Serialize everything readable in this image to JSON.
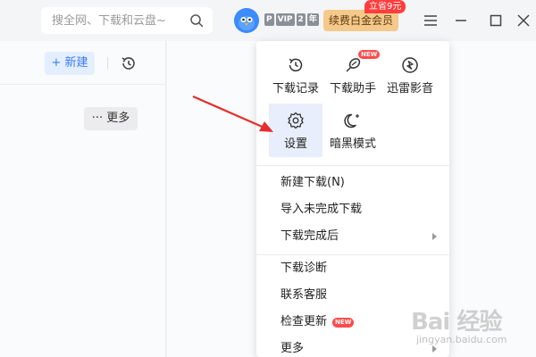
{
  "search": {
    "placeholder": "搜全网、下载和云盘~",
    "icon": "search-icon"
  },
  "account": {
    "vip_letters": [
      "P",
      "VIP",
      "2",
      "年"
    ]
  },
  "renew": {
    "label": "续费白金会员",
    "promo": "立省9元"
  },
  "left_toolbar": {
    "new_label": "新建",
    "new_plus": "+",
    "more_label": "更多",
    "more_dots": "···"
  },
  "menu": {
    "grid": [
      {
        "label": "下载记录",
        "icon": "history-icon"
      },
      {
        "label": "下载助手",
        "icon": "download-helper-icon",
        "badge": "NEW"
      },
      {
        "label": "迅雷影音",
        "icon": "player-icon"
      },
      {
        "label": "设置",
        "icon": "settings-gear-icon",
        "selected": true
      },
      {
        "label": "暗黑模式",
        "icon": "dark-mode-moon-icon"
      }
    ],
    "items": [
      {
        "label": "新建下载(N)"
      },
      {
        "label": "导入未完成下载"
      },
      {
        "label": "下载完成后",
        "submenu": true
      },
      {
        "label": "下载诊断"
      },
      {
        "label": "联系客服"
      },
      {
        "label": "检查更新",
        "badge": "NEW"
      },
      {
        "label": "更多",
        "submenu": true
      }
    ]
  },
  "watermark": {
    "main": "Bai 经验",
    "sub": "jingyan.baidu.com"
  },
  "colors": {
    "accent": "#3b7cf5",
    "selected_bg": "#e8eefb",
    "badge_red": "#ff4b4b",
    "renew_gold": "#f5c98a",
    "arrow_red": "#e52d2d"
  }
}
